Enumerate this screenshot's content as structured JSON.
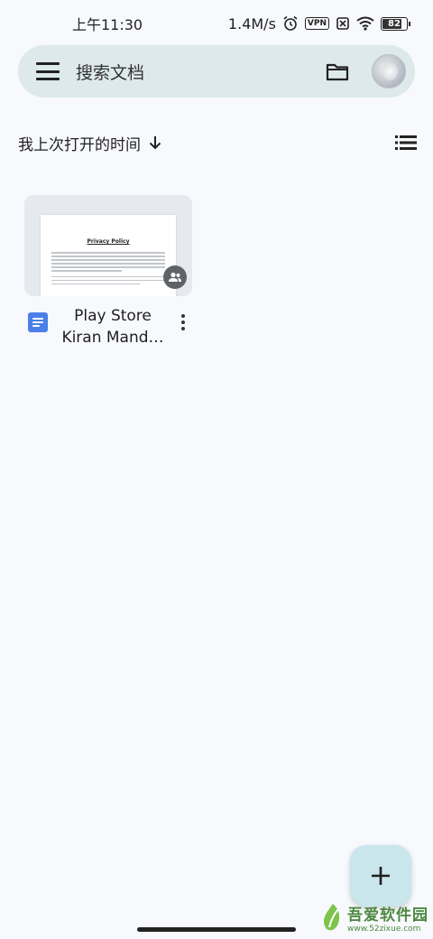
{
  "status_bar": {
    "time": "上午11:30",
    "network_speed": "1.4M/s",
    "vpn_label": "VPN",
    "battery_level": "82",
    "icons": [
      "alarm-icon",
      "vpn-icon",
      "no-sim-icon",
      "wifi-icon",
      "battery-icon"
    ]
  },
  "search": {
    "placeholder": "搜索文档",
    "icons": [
      "menu-icon",
      "folder-icon",
      "avatar"
    ]
  },
  "sort": {
    "label": "我上次打开的时间",
    "direction_icon": "arrow-down-icon",
    "view_toggle_icon": "list-view-icon"
  },
  "documents": [
    {
      "title_line1": "Play Store",
      "title_line2": "Kiran Mand…",
      "thumbnail_heading": "Privacy Policy",
      "type_icon": "google-docs-icon",
      "shared": true,
      "menu_icon": "more-vert-icon"
    }
  ],
  "fab": {
    "icon": "plus-icon"
  },
  "watermark": {
    "title": "吾爱软件园",
    "url": "www.52zixue.com"
  },
  "colors": {
    "background": "#f7f9fc",
    "search_bar": "#dde9ea",
    "fab": "#c9e6ec",
    "docs_blue": "#4a80e8"
  }
}
